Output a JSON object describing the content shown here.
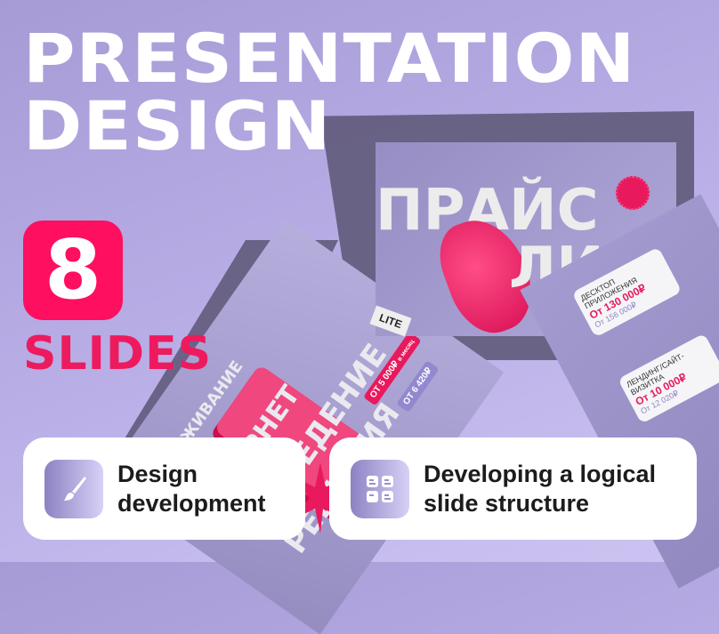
{
  "headline": {
    "line1": "PRESENTATION",
    "line2": "DESIGN"
  },
  "count": {
    "number": "8",
    "label": "SLIDES"
  },
  "slides": {
    "price_list": {
      "line1": "ПРАЙС",
      "line2": "ЛИСТ",
      "badge": "LITE"
    },
    "left": {
      "words": [
        "ВЕДЕНИЕ",
        "РЕШЕНИЯ",
        "ИНТЕРНЕТ",
        "ОБСЛУЖИВАНИЕ"
      ],
      "tag1": "ОТ 5 000₽",
      "tag1_sub": "в месяц",
      "tag2": "ОТ 6 420₽"
    },
    "right": {
      "item1_title": "ДЕСКТОП ПРИЛОЖЕНИЯ",
      "item1_price": "От 130 000₽",
      "item1_old": "От 156 000₽",
      "item2_title": "ЛЕНДИНГ/САЙТ-ВИЗИТКА",
      "item2_price": "От 10 000₽",
      "item2_old": "От 12 020₽"
    }
  },
  "features": [
    {
      "icon": "paintbrush-icon",
      "label_line1": "Design",
      "label_line2": "development"
    },
    {
      "icon": "grid-layout-icon",
      "label_line1": "Developing a logical",
      "label_line2": "slide structure"
    }
  ],
  "colors": {
    "accent": "#ff0f5f",
    "background": "#b9aee6",
    "icon_gradient_start": "#8d82c2"
  }
}
